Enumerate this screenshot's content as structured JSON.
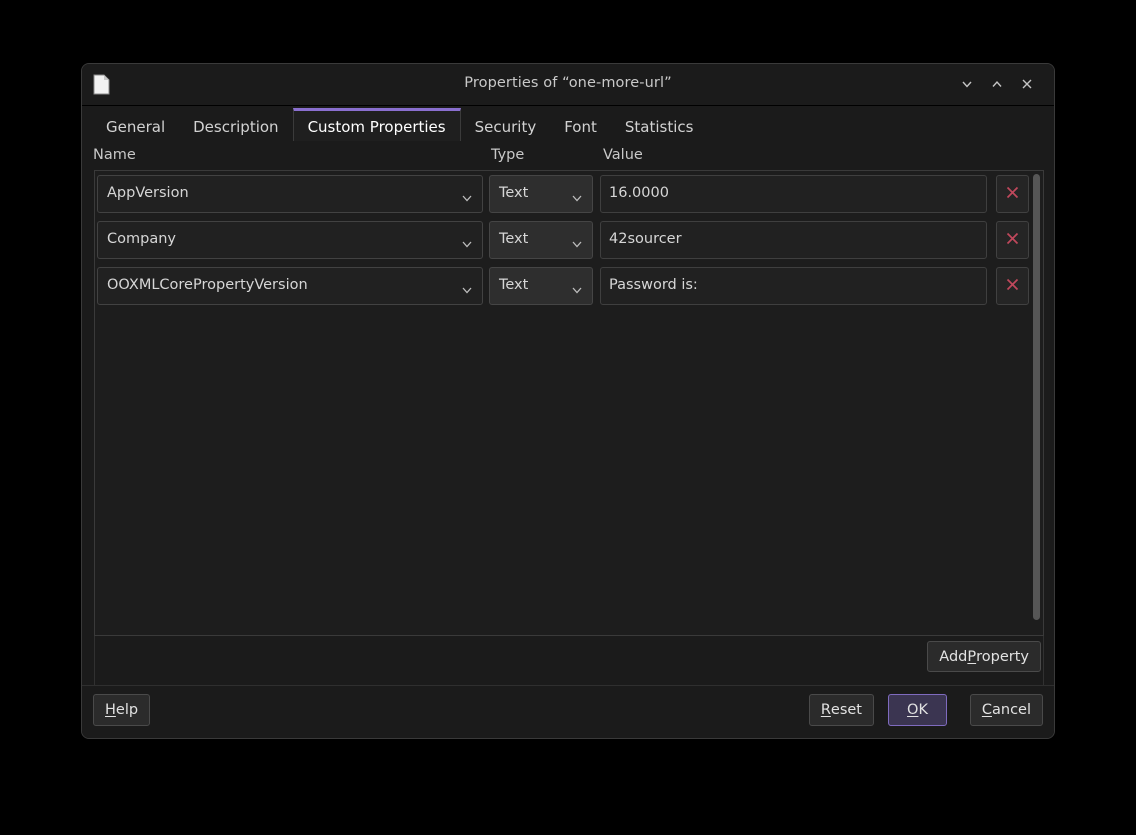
{
  "window": {
    "title": "Properties of “one-more-url”",
    "icon": "document-icon",
    "controls": {
      "minimize": "∨",
      "maximize": "∧",
      "close": "✕"
    }
  },
  "tabs": [
    {
      "label": "General",
      "active": false
    },
    {
      "label": "Description",
      "active": false
    },
    {
      "label": "Custom Properties",
      "active": true
    },
    {
      "label": "Security",
      "active": false
    },
    {
      "label": "Font",
      "active": false
    },
    {
      "label": "Statistics",
      "active": false
    }
  ],
  "columns": {
    "name": "Name",
    "type": "Type",
    "value": "Value"
  },
  "properties": [
    {
      "name": "AppVersion",
      "type": "Text",
      "value": "16.0000",
      "delete_icon": "close-x-icon"
    },
    {
      "name": "Company",
      "type": "Text",
      "value": "42sourcer",
      "delete_icon": "close-x-icon"
    },
    {
      "name": "OOXMLCorePropertyVersion",
      "type": "Text",
      "value": "Password is:",
      "delete_icon": "close-x-icon"
    }
  ],
  "add_property": {
    "prefix": "Add ",
    "mnemonic": "P",
    "suffix": "roperty"
  },
  "footer": {
    "help": {
      "mnemonic": "H",
      "rest": "elp"
    },
    "reset": {
      "mnemonic": "R",
      "rest": "eset"
    },
    "ok": {
      "mnemonic": "O",
      "rest": "K"
    },
    "cancel": {
      "mnemonic": "C",
      "rest": "ancel"
    }
  },
  "colors": {
    "accent": "#8a6fd0",
    "default_button_border": "#7f6bbf",
    "delete_icon": "#c0485c",
    "window_background": "#1b1b1b"
  }
}
